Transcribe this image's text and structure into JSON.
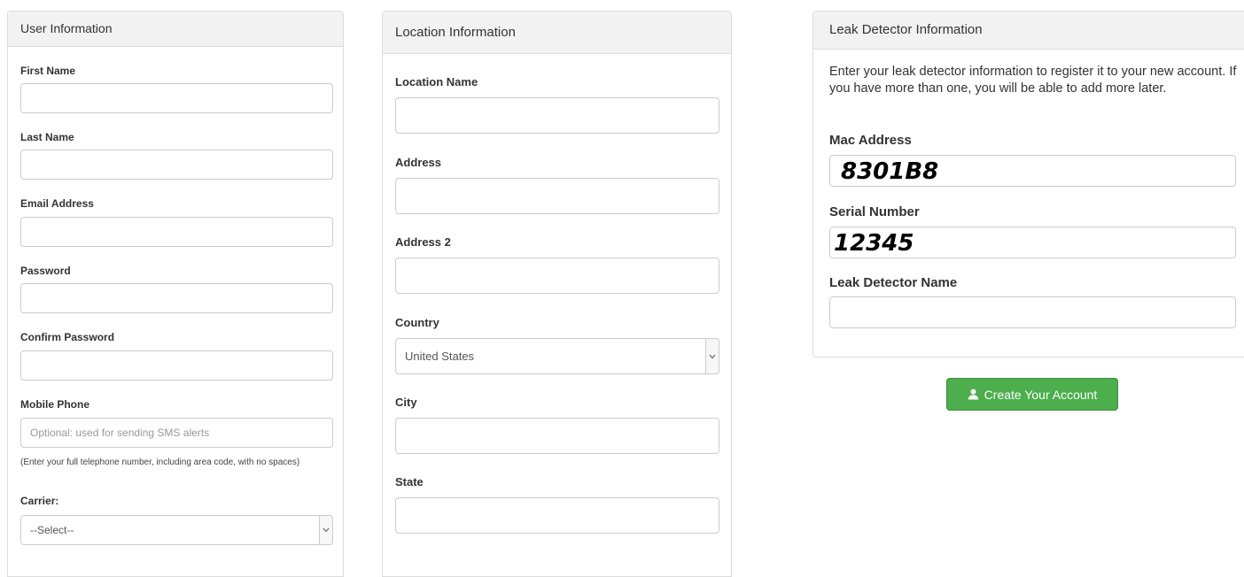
{
  "user_panel": {
    "title": "User Information",
    "first_name_label": "First Name",
    "last_name_label": "Last Name",
    "email_label": "Email Address",
    "password_label": "Password",
    "confirm_password_label": "Confirm Password",
    "mobile_label": "Mobile Phone",
    "mobile_placeholder": "Optional: used for sending SMS alerts",
    "mobile_help": "(Enter your full telephone number, including area code, with no spaces)",
    "carrier_label": "Carrier:",
    "carrier_value": "--Select--"
  },
  "location_panel": {
    "title": "Location Information",
    "location_name_label": "Location Name",
    "address_label": "Address",
    "address2_label": "Address 2",
    "country_label": "Country",
    "country_value": "United States",
    "city_label": "City",
    "state_label": "State"
  },
  "leak_panel": {
    "title": "Leak Detector Information",
    "intro": "Enter your leak detector information to register it to your new account. If you have more than one, you will be able to add more later.",
    "mac_label": "Mac Address",
    "mac_value": "8301B8",
    "serial_label": "Serial Number",
    "serial_value": "12345",
    "name_label": "Leak Detector Name"
  },
  "create_button": {
    "label": "Create Your Account",
    "icon": "user-icon",
    "color": "#4cae4c"
  }
}
